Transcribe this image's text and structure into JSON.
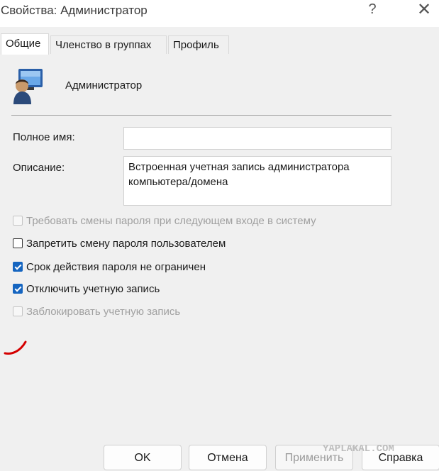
{
  "window": {
    "title": "Свойства: Администратор",
    "help_glyph": "?",
    "close_glyph": "✕"
  },
  "tabs": [
    {
      "label": "Общие",
      "active": true
    },
    {
      "label": "Членство в группах",
      "active": false
    },
    {
      "label": "Профиль",
      "active": false
    }
  ],
  "user": {
    "name": "Администратор",
    "icon": "user-account-icon"
  },
  "fields": {
    "full_name_label": "Полное имя:",
    "full_name_value": "",
    "description_label": "Описание:",
    "description_value": "Встроенная учетная запись администратора компьютера/домена"
  },
  "checkboxes": [
    {
      "label": "Требовать смены пароля при следующем входе в систему",
      "checked": false,
      "enabled": false
    },
    {
      "label": "Запретить смену пароля пользователем",
      "checked": false,
      "enabled": true
    },
    {
      "label": "Срок действия пароля не ограничен",
      "checked": true,
      "enabled": true
    },
    {
      "label": "Отключить учетную запись",
      "checked": true,
      "enabled": true
    },
    {
      "label": "Заблокировать учетную запись",
      "checked": false,
      "enabled": false
    }
  ],
  "buttons": {
    "ok": "OK",
    "cancel": "Отмена",
    "apply": "Применить",
    "help": "Справка"
  },
  "watermark": "YAPLAKAL.COM",
  "colors": {
    "accent": "#1565c0",
    "annotation": "#d40000"
  }
}
